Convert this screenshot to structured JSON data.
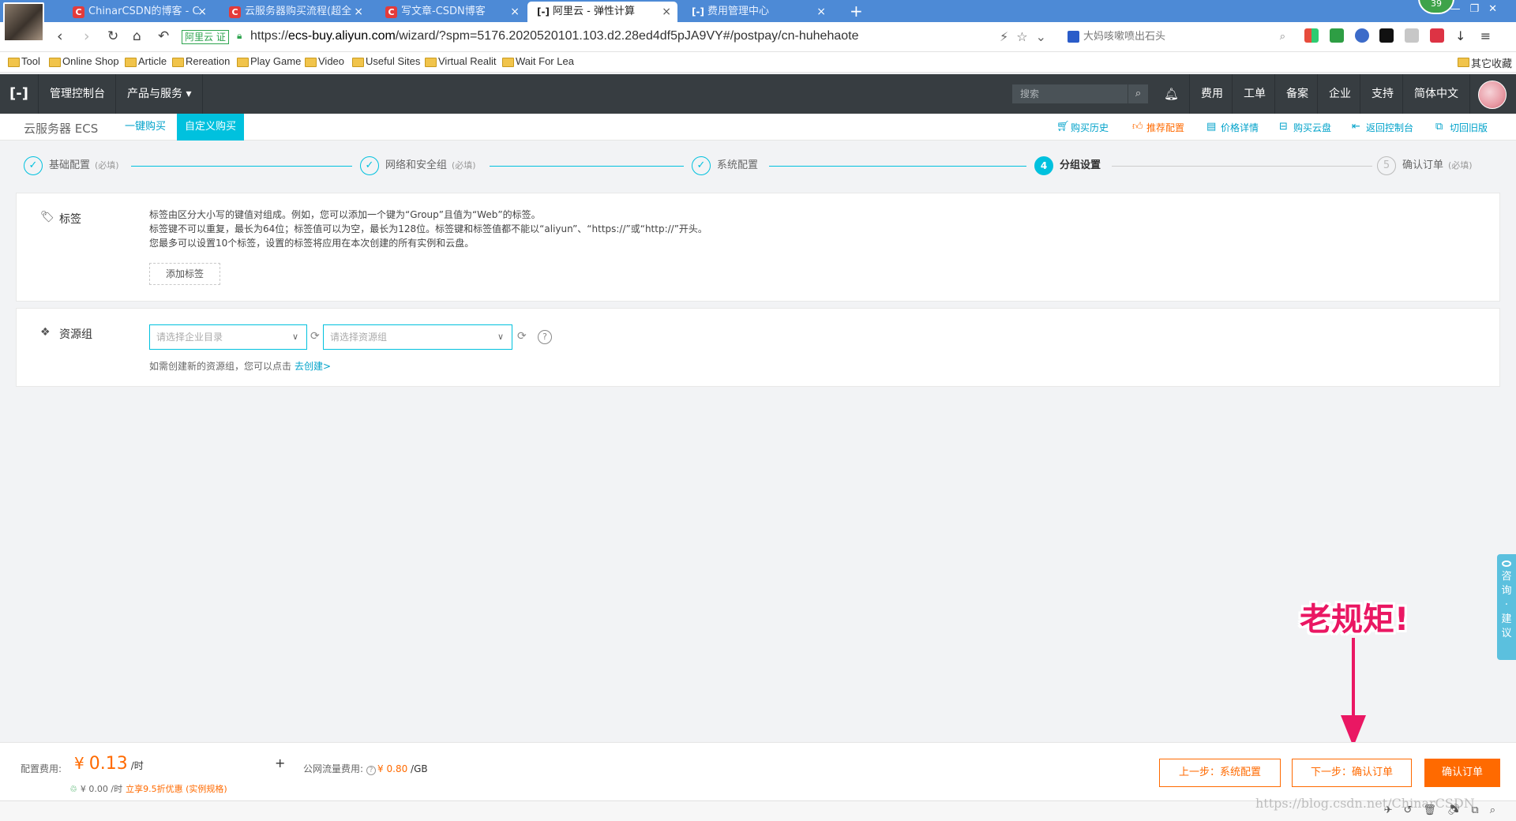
{
  "browser": {
    "tabs": [
      {
        "title": "ChinarCSDN的博客 - C",
        "icon": "csdn-icon"
      },
      {
        "title": "云服务器购买流程(超全",
        "icon": "csdn-icon"
      },
      {
        "title": "写文章-CSDN博客",
        "icon": "csdn-icon"
      },
      {
        "title": "阿里云 - 弹性计算",
        "icon": "aliyun-icon",
        "active": true
      },
      {
        "title": "费用管理中心",
        "icon": "aliyun-icon"
      }
    ],
    "badge": "39",
    "verified_label": "阿里云",
    "verified_mark": "证",
    "url_prefix": "https://",
    "url_domain": "ecs-buy.aliyun.com",
    "url_path": "/wizard/?spm=5176.2020520101.103.d2.28ed4df5pJA9VY#/postpay/cn-huhehaote",
    "search_text": "大妈咳嗽喷出石头",
    "bookmarks": [
      "Tool",
      "Online Shop",
      "Article",
      "Rereation",
      "Play Game",
      "Video",
      "Useful Sites",
      "Virtual Realit",
      "Wait For Lea"
    ],
    "other_bookmarks": "其它收藏"
  },
  "topnav": {
    "console": "管理控制台",
    "products": "产品与服务 ▾",
    "search_placeholder": "搜索",
    "links": [
      "费用",
      "工单",
      "备案",
      "企业",
      "支持",
      "简体中文"
    ]
  },
  "subnav": {
    "title": "云服务器 ECS",
    "tabs": [
      "一键购买",
      "自定义购买"
    ],
    "links": [
      "购买历史",
      "推荐配置",
      "价格详情",
      "购买云盘",
      "返回控制台",
      "切回旧版"
    ]
  },
  "steps": [
    {
      "number": "✓",
      "label": "基础配置",
      "req": "(必填)",
      "state": "done"
    },
    {
      "number": "✓",
      "label": "网络和安全组",
      "req": "(必填)",
      "state": "done"
    },
    {
      "number": "✓",
      "label": "系统配置",
      "req": "",
      "state": "done"
    },
    {
      "number": "4",
      "label": "分组设置",
      "req": "",
      "state": "current"
    },
    {
      "number": "5",
      "label": "确认订单",
      "req": "(必填)",
      "state": "todo"
    }
  ],
  "tags": {
    "label": "标签",
    "desc": [
      "标签由区分大小写的键值对组成。例如，您可以添加一个键为“Group”且值为“Web”的标签。",
      "标签键不可以重复，最长为64位；标签值可以为空，最长为128位。标签键和标签值都不能以“aliyun”、“https://”或“http://”开头。",
      "您最多可以设置10个标签，设置的标签将应用在本次创建的所有实例和云盘。"
    ],
    "add_button": "添加标签"
  },
  "resource_group": {
    "label": "资源组",
    "enterprise_placeholder": "请选择企业目录",
    "group_placeholder": "请选择资源组",
    "hint": "如需创建新的资源组，您可以点击",
    "create_link": "去创建>"
  },
  "feedback": [
    "咨",
    "询",
    "·",
    "建",
    "议"
  ],
  "annotation": "老规矩!",
  "footer": {
    "config_fee_label": "配置费用:",
    "currency": "¥",
    "price": "0.13",
    "unit": "/时",
    "sub_price": "¥ 0.00 /时",
    "discount": "立享9.5折优惠 (实例规格)",
    "plus": "+",
    "traffic_label": "公网流量费用:",
    "traffic_value": "¥ 0.80",
    "traffic_unit": "/GB",
    "prev_button": "上一步：系统配置",
    "next_button": "下一步：确认订单",
    "confirm_button": "确认订单"
  },
  "watermark": "https://blog.csdn.net/ChinarCSDN"
}
